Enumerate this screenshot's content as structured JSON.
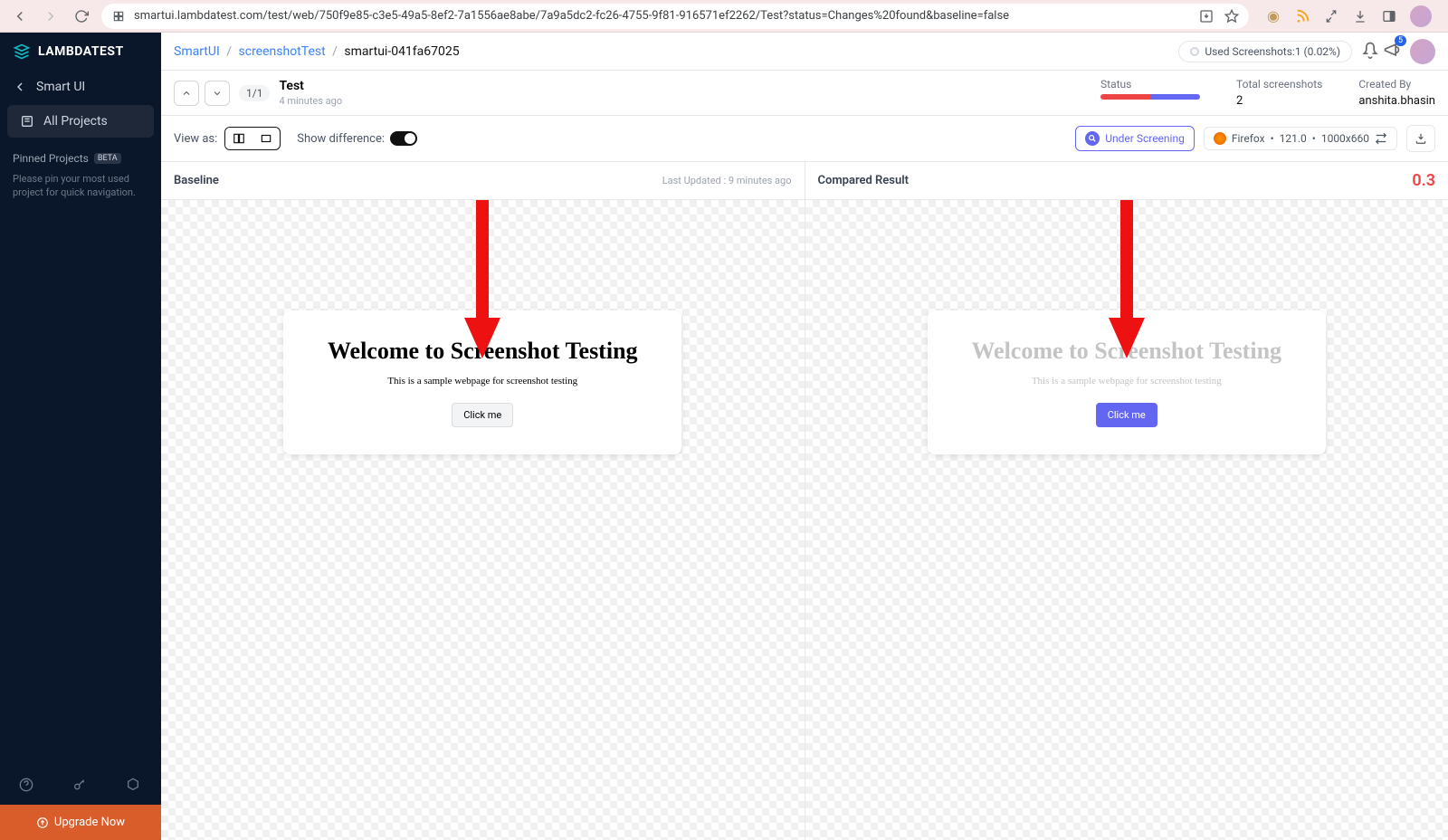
{
  "browser": {
    "url": "smartui.lambdatest.com/test/web/750f9e85-c3e5-49a5-8ef2-7a1556ae8abe/7a9a5dc2-fc26-4755-9f81-916571ef2262/Test?status=Changes%20found&baseline=false",
    "badge": "5"
  },
  "sidebar": {
    "brand": "LAMBDATEST",
    "items": [
      {
        "label": "Smart UI"
      },
      {
        "label": "All Projects"
      }
    ],
    "pinned_title": "Pinned Projects",
    "beta": "BETA",
    "pinned_hint": "Please pin your most used project for quick navigation.",
    "upgrade": "Upgrade Now"
  },
  "breadcrumb": {
    "a": "SmartUI",
    "b": "screenshotTest",
    "c": "smartui-041fa67025"
  },
  "usage": "Used Screenshots:1 (0.02%)",
  "test": {
    "count": "1/1",
    "name": "Test",
    "time": "4 minutes ago"
  },
  "meta": {
    "status_label": "Status",
    "total_label": "Total screenshots",
    "total_val": "2",
    "created_label": "Created By",
    "created_val": "anshita.bhasin"
  },
  "toolbar": {
    "view_as": "View as:",
    "diff": "Show difference:",
    "screening": "Under Screening",
    "firefox": "Firefox",
    "ff_ver": "121.0",
    "res": "1000x660"
  },
  "panels": {
    "baseline": "Baseline",
    "updated": "Last Updated : 9 minutes ago",
    "compared": "Compared Result",
    "diff_pct": "0.3"
  },
  "sample": {
    "title": "Welcome to Screenshot Testing",
    "subtitle": "This is a sample webpage for screenshot testing",
    "button": "Click me"
  }
}
